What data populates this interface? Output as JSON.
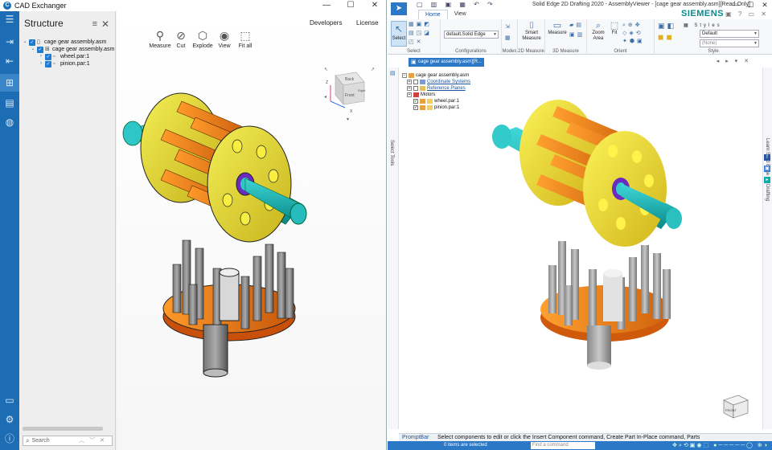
{
  "cad_exchanger": {
    "title": "CAD Exchanger",
    "window_controls": [
      "—",
      "☐",
      "✕"
    ],
    "sidebar": {
      "title": "Structure",
      "tree": [
        {
          "label": "cage gear assembly.asm",
          "level": 0
        },
        {
          "label": "cage gear assembly.asm",
          "level": 1
        },
        {
          "label": "wheel.par:1",
          "level": 2
        },
        {
          "label": "pinion.par:1",
          "level": 2
        }
      ],
      "search_placeholder": "Search"
    },
    "toolbar": [
      {
        "id": "measure",
        "label": "Measure",
        "icon": "⚲"
      },
      {
        "id": "cut",
        "label": "Cut",
        "icon": "⊘"
      },
      {
        "id": "explode",
        "label": "Explode",
        "icon": "⬡"
      },
      {
        "id": "view",
        "label": "View",
        "icon": "◉"
      },
      {
        "id": "fit",
        "label": "Fit all",
        "icon": "⬚"
      }
    ],
    "top_menu": [
      "Developers",
      "License"
    ],
    "navcube": {
      "top": "Back",
      "front": "Front",
      "right": "Right",
      "x_label": "X",
      "z_label": "Z"
    }
  },
  "solid_edge": {
    "title": "Solid Edge 2D Drafting 2020 - AssemblyViewer - [cage gear assembly.asm][Read-Only]",
    "brand": "SIEMENS",
    "tabs": [
      "Home",
      "View"
    ],
    "active_tab": "Home",
    "ribbon": {
      "select_label": "Select",
      "configurations_value": "default,Solid Edge",
      "groups": [
        "Select",
        "Configurations",
        "Modes",
        "2D Measure",
        "3D Measure",
        "Orient",
        "Style"
      ],
      "smart_measure": "Smart Measure",
      "measure": "Measure",
      "zoom_area": "Zoom Area",
      "fit": "Fit",
      "styles_label": "Styles",
      "style_value": "Default",
      "style_none": "(None)"
    },
    "document_tab": "cage gear assembly.asm][R...",
    "left_strip_label": "Select Tools",
    "right_strip_label": "Learn Solid Edge 2D Drafting",
    "pathfinder": [
      {
        "label": "cage gear assembly.asm",
        "kind": "root"
      },
      {
        "label": "Coordinate Systems",
        "kind": "link"
      },
      {
        "label": "Reference Planes",
        "kind": "link"
      },
      {
        "label": "Motors",
        "kind": "folder"
      },
      {
        "label": "wheel.par:1",
        "kind": "part"
      },
      {
        "label": "pinion.par:1",
        "kind": "part"
      }
    ],
    "prompt_label": "PromptBar",
    "prompt_text": "Select components to edit or click the Insert Component command, Create Part In-Place command, Parts",
    "status_items": "0 items are selected",
    "find_placeholder": "Find a command",
    "colors": {
      "accent": "#2a78c6",
      "siemens": "#0a8a8f",
      "cx_rail": "#1d6db4"
    }
  }
}
